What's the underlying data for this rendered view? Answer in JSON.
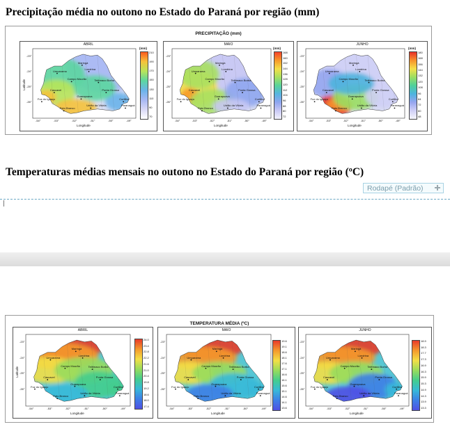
{
  "headings": {
    "precip": "Precipitação média no outono no Estado do Paraná por região (mm)",
    "temp": "Temperaturas médias mensais no outono no Estado do Paraná por região (ºC)"
  },
  "footer_tag": "Rodapé (Padrão)",
  "precip_figure": {
    "title": "PRECIPITAÇÃO (mm)",
    "ylabel": "Latitude",
    "xlabel": "Longitude",
    "panels": [
      {
        "month": "ABRIL",
        "unit": "(mm)",
        "ticks": [
          "210",
          "190",
          "170",
          "150",
          "130",
          "110",
          "90",
          "70"
        ],
        "colors": [
          "#fa5a1e",
          "#f6c23a",
          "#b8e55a",
          "#5cd6a0",
          "#6ab4ea",
          "#a7b8f4",
          "#d8d8f6",
          "#ffffff"
        ]
      },
      {
        "month": "MAIO",
        "unit": "(mm)",
        "ticks": [
          "168",
          "160",
          "152",
          "144",
          "136",
          "128",
          "120",
          "112",
          "104",
          "96",
          "88",
          "80",
          "72"
        ],
        "colors": [
          "#f5432a",
          "#f79a2a",
          "#f4df48",
          "#a8e060",
          "#58d39a",
          "#56b5e0",
          "#8fa6f0",
          "#c8c8f4",
          "#f2f2fc"
        ]
      },
      {
        "month": "JUNHO",
        "unit": "(mm)",
        "ticks": [
          "180",
          "168",
          "156",
          "144",
          "132",
          "120",
          "108",
          "96",
          "84",
          "72",
          "60",
          "48"
        ],
        "colors": [
          "#e8302a",
          "#f7932c",
          "#f5e04a",
          "#9ade62",
          "#4fd09a",
          "#4db4de",
          "#95a5ef",
          "#cfcff6",
          "#f5f5fd"
        ]
      }
    ]
  },
  "temp_figure": {
    "title": "TEMPERATURA  MÉDIA (ºC)",
    "ylabel": "Latitude",
    "xlabel": "Longitude",
    "panels": [
      {
        "month": "ABRIL",
        "ticks": [
          "24.0",
          "23.4",
          "22.8",
          "22.2",
          "21.6",
          "21.0",
          "20.4",
          "19.8",
          "19.2",
          "18.6",
          "18.0",
          "17.4"
        ],
        "colors": [
          "#e83a2a",
          "#f49a2c",
          "#f3df46",
          "#98dc5c",
          "#44cd8e",
          "#37b9d8",
          "#3d7fe6",
          "#5050e4"
        ]
      },
      {
        "month": "MAIO",
        "ticks": [
          "19.6",
          "19.1",
          "18.6",
          "18.1",
          "17.6",
          "17.1",
          "16.6",
          "16.1",
          "15.6",
          "15.1",
          "14.6",
          "14.1",
          "13.6"
        ],
        "colors": [
          "#e83a2a",
          "#f49a2c",
          "#f3df46",
          "#98dc5c",
          "#44cd8e",
          "#37b9d8",
          "#3d7fe6",
          "#5050e4"
        ]
      },
      {
        "month": "JUNHO",
        "ticks": [
          "18.9",
          "18.3",
          "17.7",
          "17.3",
          "16.9",
          "16.3",
          "15.9",
          "15.3",
          "14.9",
          "14.3",
          "13.9",
          "13.3"
        ],
        "colors": [
          "#e83a2a",
          "#f49a2c",
          "#f3df46",
          "#98dc5c",
          "#44cd8e",
          "#37b9d8",
          "#3d7fe6",
          "#5050e4"
        ]
      }
    ]
  },
  "cities": {
    "maringa": "Maringá",
    "londrina": "Londrina",
    "umuarama": "Umuarama",
    "campo_mourao": "Campo Mourão",
    "telemaco": "Telêmaco Borba",
    "cascavel": "Cascavel",
    "ponta_grossa": "Ponta Grossa",
    "guarapuava": "Guarapuava",
    "foz": "Foz do Iguaçu",
    "curitiba": "Curitiba",
    "paranagua": "Paranaguá",
    "pato_branco": "Pato Branco",
    "uniao": "União da Vitória"
  },
  "lon_ticks": [
    "-54°",
    "-53°",
    "-52°",
    "-51°",
    "-50°",
    "-49°"
  ],
  "lat_ticks": [
    "-23°",
    "-24°",
    "-25°",
    "-26°"
  ]
}
